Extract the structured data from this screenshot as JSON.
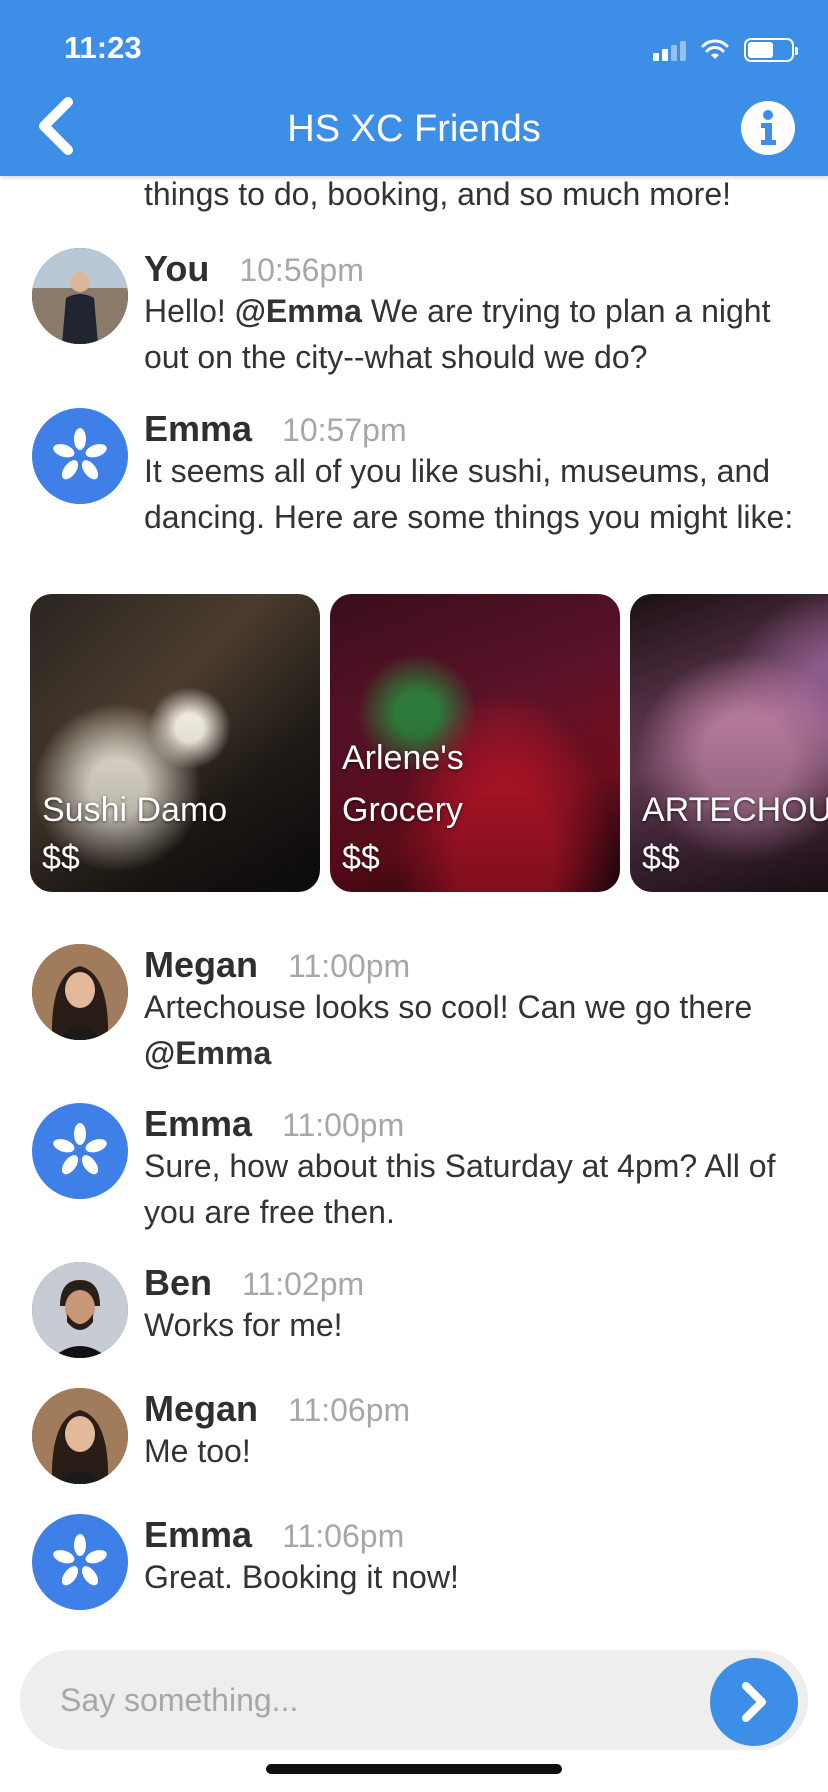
{
  "status_bar": {
    "time": "11:23"
  },
  "header": {
    "title": "HS XC Friends"
  },
  "chat": {
    "partial_text": "things to do, booking, and so much more!",
    "messages": [
      {
        "name": "You",
        "time": "10:56pm",
        "pre": "Hello! ",
        "mention": "@Emma",
        "post": " We are trying to plan a night out on the city--what should we do?"
      },
      {
        "name": "Emma",
        "time": "10:57pm",
        "text": "It seems all of you like sushi, museums, and dancing. Here are some things you might like:"
      },
      {
        "name": "Megan",
        "time": "11:00pm",
        "pre": "Artechouse looks so cool! Can we go there ",
        "mention": "@Emma",
        "post": ""
      },
      {
        "name": "Emma",
        "time": "11:00pm",
        "text": "Sure, how about this Saturday at 4pm? All of you are free then."
      },
      {
        "name": "Ben",
        "time": "11:02pm",
        "text": "Works for me!"
      },
      {
        "name": "Megan",
        "time": "11:06pm",
        "text": "Me too!"
      },
      {
        "name": "Emma",
        "time": "11:06pm",
        "text": "Great. Booking it now!"
      }
    ],
    "cards": [
      {
        "name": "Sushi Damo",
        "price": "$$"
      },
      {
        "name": "Arlene's Grocery",
        "price": "$$"
      },
      {
        "name": "ARTECHOUSE",
        "price": "$$"
      }
    ]
  },
  "composer": {
    "placeholder": "Say something..."
  },
  "colors": {
    "brand": "#3d8ee6",
    "bot_avatar": "#3e7fe8"
  },
  "icons": {
    "back": "chevron-left-icon",
    "info": "info-icon",
    "send": "chevron-right-icon",
    "bot": "flower-logo-icon"
  }
}
